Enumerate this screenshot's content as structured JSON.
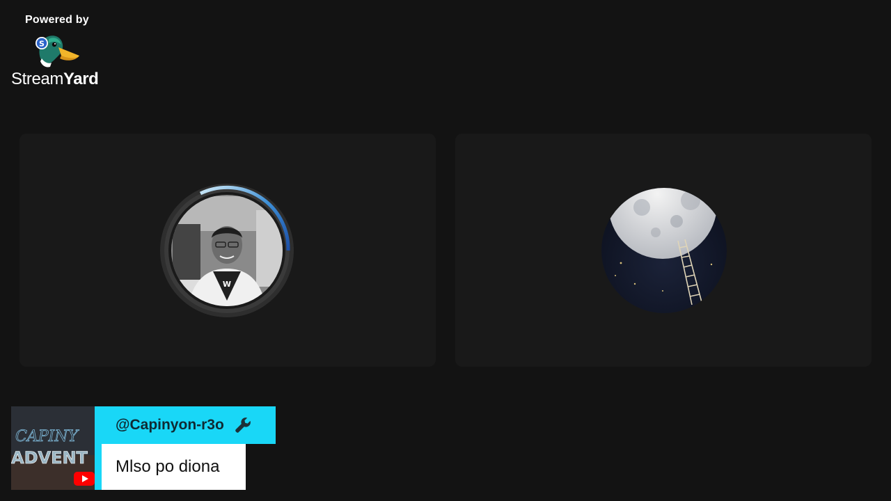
{
  "branding": {
    "powered_by": "Powered by",
    "name_regular": "Stream",
    "name_bold": "Yard",
    "logo_icon": "streamyard-duck-icon"
  },
  "participants": [
    {
      "avatar": "person-photo-avatar",
      "style": "grayscale",
      "speaking_ring": true
    },
    {
      "avatar": "moon-ladder-avatar",
      "style": "color",
      "speaking_ring": false
    }
  ],
  "comment_banner": {
    "username": "@Capinyon-r3o",
    "message": "Mlso po diona",
    "badge_icon": "wrench-icon",
    "platform_icon": "youtube-icon",
    "thumbnail_text": "ADVENT",
    "accent_color": "#19d7f7"
  },
  "colors": {
    "background": "#131313",
    "tile": "#191919",
    "accent": "#19d7f7"
  }
}
